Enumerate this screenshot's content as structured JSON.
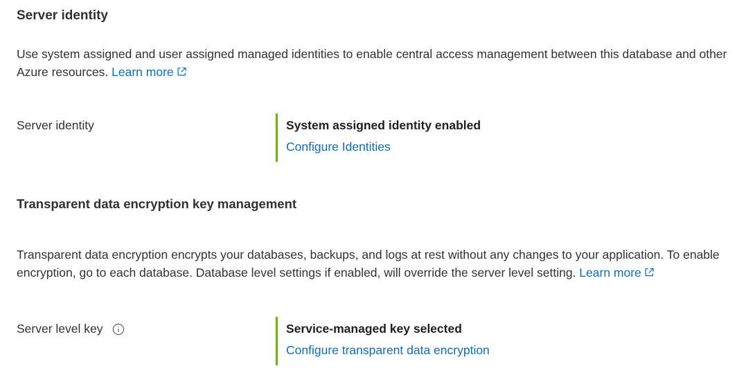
{
  "identity_section": {
    "heading": "Server identity",
    "description": "Use system assigned and user assigned managed identities to enable central access management between this database and other Azure resources.",
    "learn_more": "Learn more",
    "row_label": "Server identity",
    "status": "System assigned identity enabled",
    "action_link": "Configure Identities"
  },
  "tde_section": {
    "heading": "Transparent data encryption key management",
    "description": "Transparent data encryption encrypts your databases, backups, and logs at rest without any changes to your application. To enable encryption, go to each database. Database level settings if enabled, will override the server level setting.",
    "learn_more": "Learn more",
    "row_label": "Server level key",
    "status": "Service-managed key selected",
    "action_link": "Configure transparent data encryption"
  },
  "colors": {
    "link": "#0f6cbd",
    "accent_bar": "#6bb700",
    "text": "#323130"
  },
  "icons": {
    "external_link": "external-link-icon",
    "info": "info-icon"
  }
}
